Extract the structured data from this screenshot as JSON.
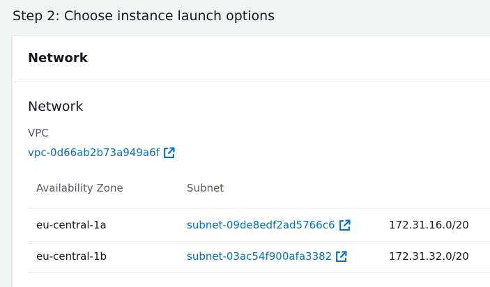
{
  "page": {
    "step_title": "Step 2: Choose instance launch options"
  },
  "panel": {
    "header_title": "Network",
    "section_title": "Network",
    "vpc": {
      "label": "VPC",
      "value": "vpc-0d66ab2b73a949a6f",
      "icon": "external-link-icon"
    },
    "table": {
      "columns": [
        "Availability Zone",
        "Subnet",
        ""
      ],
      "rows": [
        {
          "availability_zone": "eu-central-1a",
          "subnet": "subnet-09de8edf2ad5766c6",
          "cidr": "172.31.16.0/20"
        },
        {
          "availability_zone": "eu-central-1b",
          "subnet": "subnet-03ac54f900afa3382",
          "cidr": "172.31.32.0/20"
        }
      ]
    }
  },
  "colors": {
    "link": "#0073bb",
    "background": "#f2f3f3",
    "panel": "#ffffff",
    "text": "#16191f",
    "muted_text": "#545b64"
  }
}
